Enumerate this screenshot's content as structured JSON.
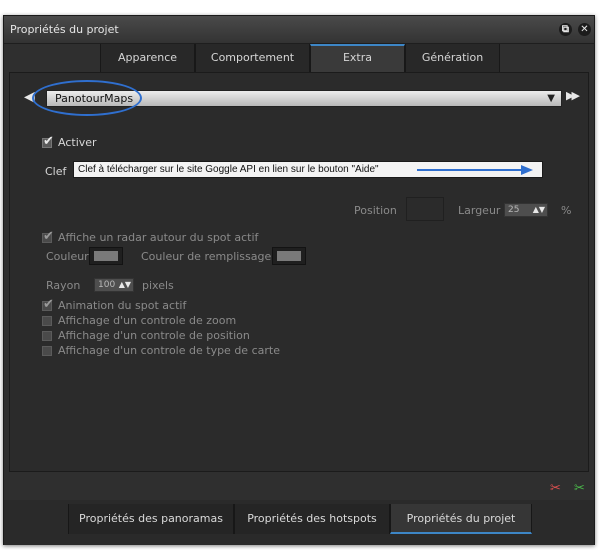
{
  "window": {
    "title": "Propriétés du projet"
  },
  "titlebar": {
    "restore_glyph": "⧉",
    "close_glyph": "✕"
  },
  "tabs_top": [
    {
      "label": "Apparence",
      "active": false
    },
    {
      "label": "Comportement",
      "active": false
    },
    {
      "label": "Extra",
      "active": true
    },
    {
      "label": "Génération",
      "active": false
    }
  ],
  "plugin_select": {
    "value": "PanotourMaps",
    "prev_glyph": "◀",
    "next_glyph": "▶▶",
    "caret_glyph": "▼"
  },
  "activer": {
    "label": "Activer",
    "checked": true
  },
  "clef": {
    "label": "Clef",
    "value": "Clef à télécharger sur le site Goggle API en lien sur le bouton \"Aide\"",
    "help_glyph": "?"
  },
  "position": {
    "label": "Position",
    "largeur_label": "Largeur",
    "largeur_value": "25",
    "percent": "%"
  },
  "radar": {
    "checkbox_label": "Affiche un radar autour du spot actif",
    "couleur_label": "Couleur",
    "couleur_remplissage_label": "Couleur de remplissage",
    "rayon_label": "Rayon",
    "rayon_value": "100",
    "pixels_label": "pixels"
  },
  "options": [
    {
      "label": "Animation du spot actif",
      "checked": true
    },
    {
      "label": "Affichage d'un controle de zoom",
      "checked": false
    },
    {
      "label": "Affichage d'un controle de position",
      "checked": false
    },
    {
      "label": "Affichage d'un controle de type de carte",
      "checked": false
    }
  ],
  "tabs_bottom": [
    {
      "label": "Propriétés des panoramas",
      "active": false
    },
    {
      "label": "Propriétés des hotspots",
      "active": false
    },
    {
      "label": "Propriétés du projet",
      "active": true
    }
  ],
  "icons": {
    "tick": "✔",
    "spin_arrows": "▲▼"
  },
  "colors": {
    "accent": "#3d86c6",
    "annotation": "#2f6fcf",
    "help": "#2a7bd8"
  }
}
